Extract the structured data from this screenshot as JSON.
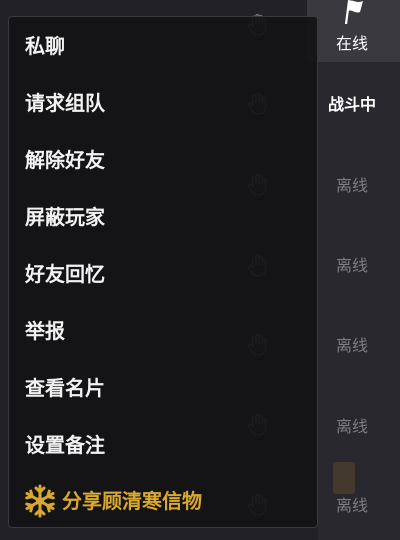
{
  "menu": {
    "items": [
      "私聊",
      "请求组队",
      "解除好友",
      "屏蔽玩家",
      "好友回忆",
      "举报",
      "查看名片",
      "设置备注"
    ],
    "special_item": {
      "label": "分享顾清寒信物",
      "icon": "snowflake-icon"
    }
  },
  "status_column": {
    "header_icon": "flag-icon",
    "statuses": [
      "在线",
      "战斗中",
      "离线",
      "离线",
      "离线",
      "离线",
      "离线"
    ]
  },
  "row_action_icon": "hand-wave-icon",
  "colors": {
    "menu_text": "#f2f2f2",
    "accent_gold": "#d9a830",
    "online_text": "#ffffff",
    "offline_text": "#7d7d82"
  }
}
